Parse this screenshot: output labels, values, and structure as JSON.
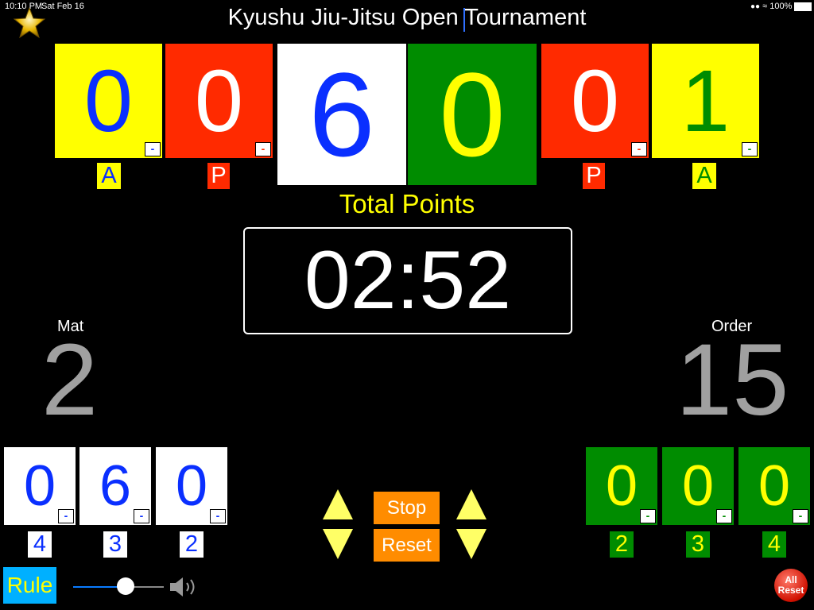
{
  "status_bar": {
    "time": "10:10 PM",
    "date": "Sat Feb 16",
    "battery": "100%"
  },
  "title": "Kyushu Jiu-Jitsu Open Tournament",
  "top_scores": {
    "left_advantage": "0",
    "left_penalty": "0",
    "left_points": "6",
    "right_points": "0",
    "right_penalty": "0",
    "right_advantage": "1",
    "minus": "-"
  },
  "top_labels": {
    "a": "A",
    "p": "P"
  },
  "total_points_label": "Total Points",
  "timer": "02:52",
  "mat": {
    "label": "Mat",
    "value": "2"
  },
  "order": {
    "label": "Order",
    "value": "15"
  },
  "left_sub": {
    "values": [
      "0",
      "6",
      "0"
    ],
    "labels": [
      "4",
      "3",
      "2"
    ]
  },
  "right_sub": {
    "values": [
      "0",
      "0",
      "0"
    ],
    "labels": [
      "2",
      "3",
      "4"
    ]
  },
  "buttons": {
    "stop": "Stop",
    "reset": "Reset",
    "rule": "Rule",
    "all_reset_1": "All",
    "all_reset_2": "Reset"
  },
  "volume": {
    "level": 0.58
  },
  "colors": {
    "yellow": "#ffff00",
    "red": "#ff2a00",
    "green": "#008c00",
    "blue": "#0a2fff",
    "orange": "#ff8c00",
    "gray": "#a0a0a0"
  }
}
